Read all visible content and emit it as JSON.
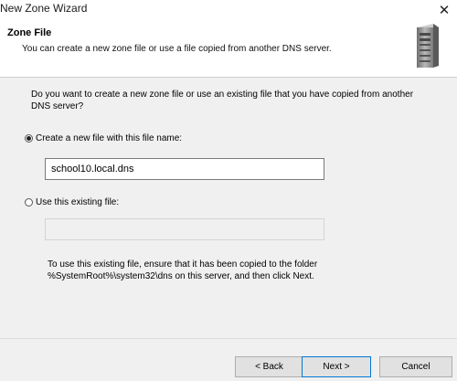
{
  "window": {
    "title": "New Zone Wizard",
    "close_glyph": "✕"
  },
  "header": {
    "title": "Zone File",
    "subtitle": "You can create a new zone file or use a file copied from another DNS server.",
    "icon": "server-icon"
  },
  "body": {
    "question": "Do you want to create a new zone file or use an existing file that you have copied from another DNS server?",
    "options": [
      {
        "label": "Create a new file with this file name:",
        "checked": true
      },
      {
        "label": "Use this existing file:",
        "checked": false
      }
    ],
    "new_file_value": "school10.local.dns",
    "existing_file_value": "",
    "note": "To use this existing file, ensure that it has been copied to the folder %SystemRoot%\\system32\\dns on this server, and then click Next."
  },
  "footer": {
    "back_label": "< Back",
    "next_label": "Next >",
    "cancel_label": "Cancel"
  }
}
